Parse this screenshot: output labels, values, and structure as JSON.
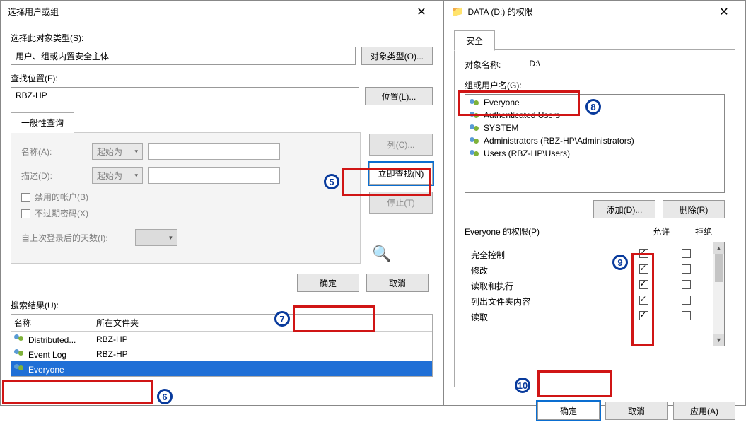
{
  "left": {
    "title": "选择用户或组",
    "obj_type_label": "选择此对象类型(S):",
    "obj_type_value": "用户、组或内置安全主体",
    "obj_type_btn": "对象类型(O)...",
    "location_label": "查找位置(F):",
    "location_value": "RBZ-HP",
    "location_btn": "位置(L)...",
    "tab_general": "一般性查询",
    "name_label": "名称(A):",
    "name_combo": "起始为",
    "desc_label": "描述(D):",
    "desc_combo": "起始为",
    "chk_disabled": "禁用的帐户(B)",
    "chk_noexpire": "不过期密码(X)",
    "days_label": "自上次登录后的天数(I):",
    "btn_columns": "列(C)...",
    "btn_findnow": "立即查找(N)",
    "btn_stop": "停止(T)",
    "btn_ok": "确定",
    "btn_cancel": "取消",
    "results_label": "搜索结果(U):",
    "col_name": "名称",
    "col_folder": "所在文件夹",
    "rows": [
      {
        "name": "Distributed...",
        "folder": "RBZ-HP",
        "sel": false
      },
      {
        "name": "Event Log",
        "folder": "RBZ-HP",
        "sel": false
      },
      {
        "name": "Everyone",
        "folder": "",
        "sel": true
      }
    ]
  },
  "right": {
    "title": "DATA (D:) 的权限",
    "tab_security": "安全",
    "obj_name_label": "对象名称:",
    "obj_name_value": "D:\\",
    "group_label": "组或用户名(G):",
    "principals": [
      "Everyone",
      "Authenticated Users",
      "SYSTEM",
      "Administrators (RBZ-HP\\Administrators)",
      "Users (RBZ-HP\\Users)"
    ],
    "btn_add": "添加(D)...",
    "btn_remove": "删除(R)",
    "perm_label": "Everyone 的权限(P)",
    "perm_allow": "允许",
    "perm_deny": "拒绝",
    "perms": [
      {
        "name": "完全控制",
        "allow": true,
        "deny": false
      },
      {
        "name": "修改",
        "allow": true,
        "deny": false
      },
      {
        "name": "读取和执行",
        "allow": true,
        "deny": false
      },
      {
        "name": "列出文件夹内容",
        "allow": true,
        "deny": false
      },
      {
        "name": "读取",
        "allow": true,
        "deny": false
      }
    ],
    "btn_ok": "确定",
    "btn_cancel": "取消",
    "btn_apply": "应用(A)"
  },
  "annotations": {
    "b5": "5",
    "b6": "6",
    "b7": "7",
    "b8": "8",
    "b9": "9",
    "b10": "10"
  }
}
